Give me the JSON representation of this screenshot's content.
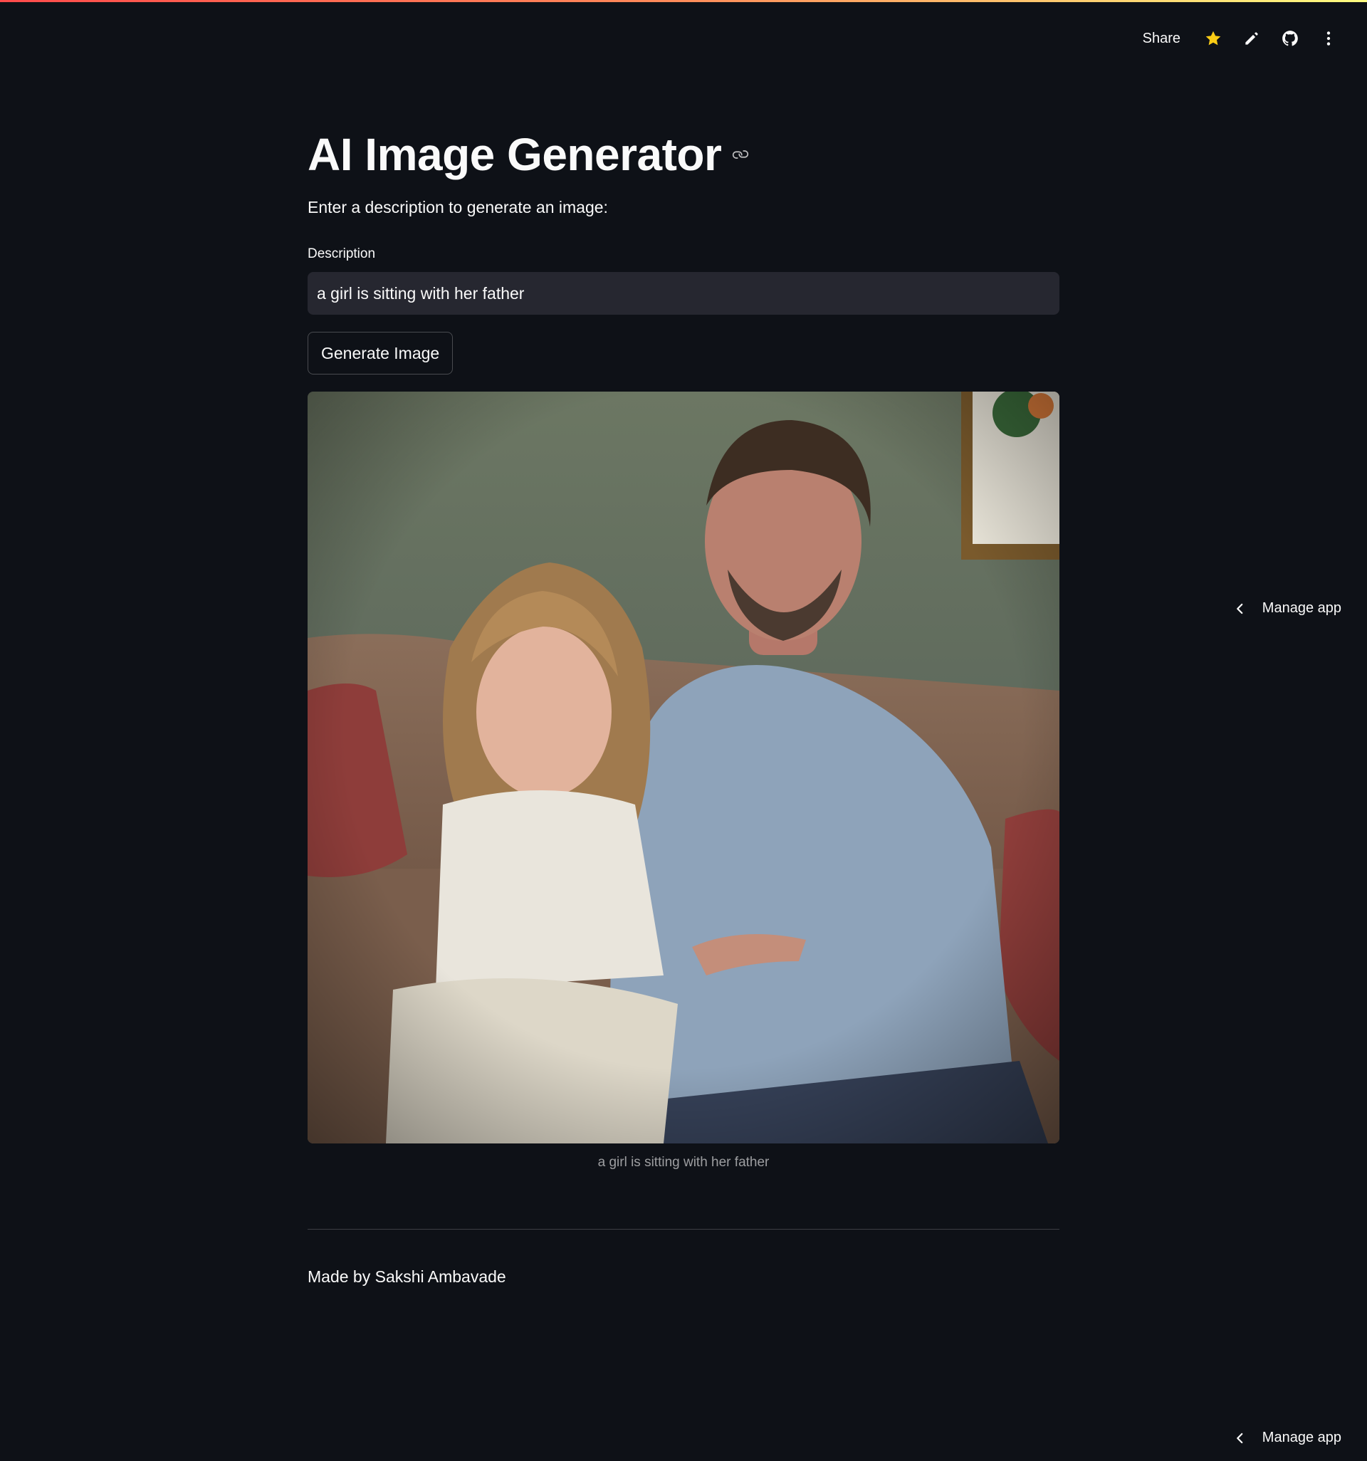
{
  "toolbar": {
    "share_label": "Share",
    "icons": [
      "star-icon",
      "pencil-icon",
      "github-icon",
      "kebab-menu-icon"
    ],
    "star_color": "#facc15"
  },
  "main": {
    "title": "AI Image Generator",
    "subtitle": "Enter a description to generate an image:",
    "description_label": "Description",
    "description_value": "a girl is sitting with her father",
    "generate_button": "Generate Image",
    "image_caption": "a girl is sitting with her father",
    "footer": "Made by Sakshi Ambavade"
  },
  "manage_app": {
    "label": "Manage app"
  },
  "colors": {
    "background": "#0e1117",
    "input_background": "#262730",
    "text": "#fafafa"
  }
}
